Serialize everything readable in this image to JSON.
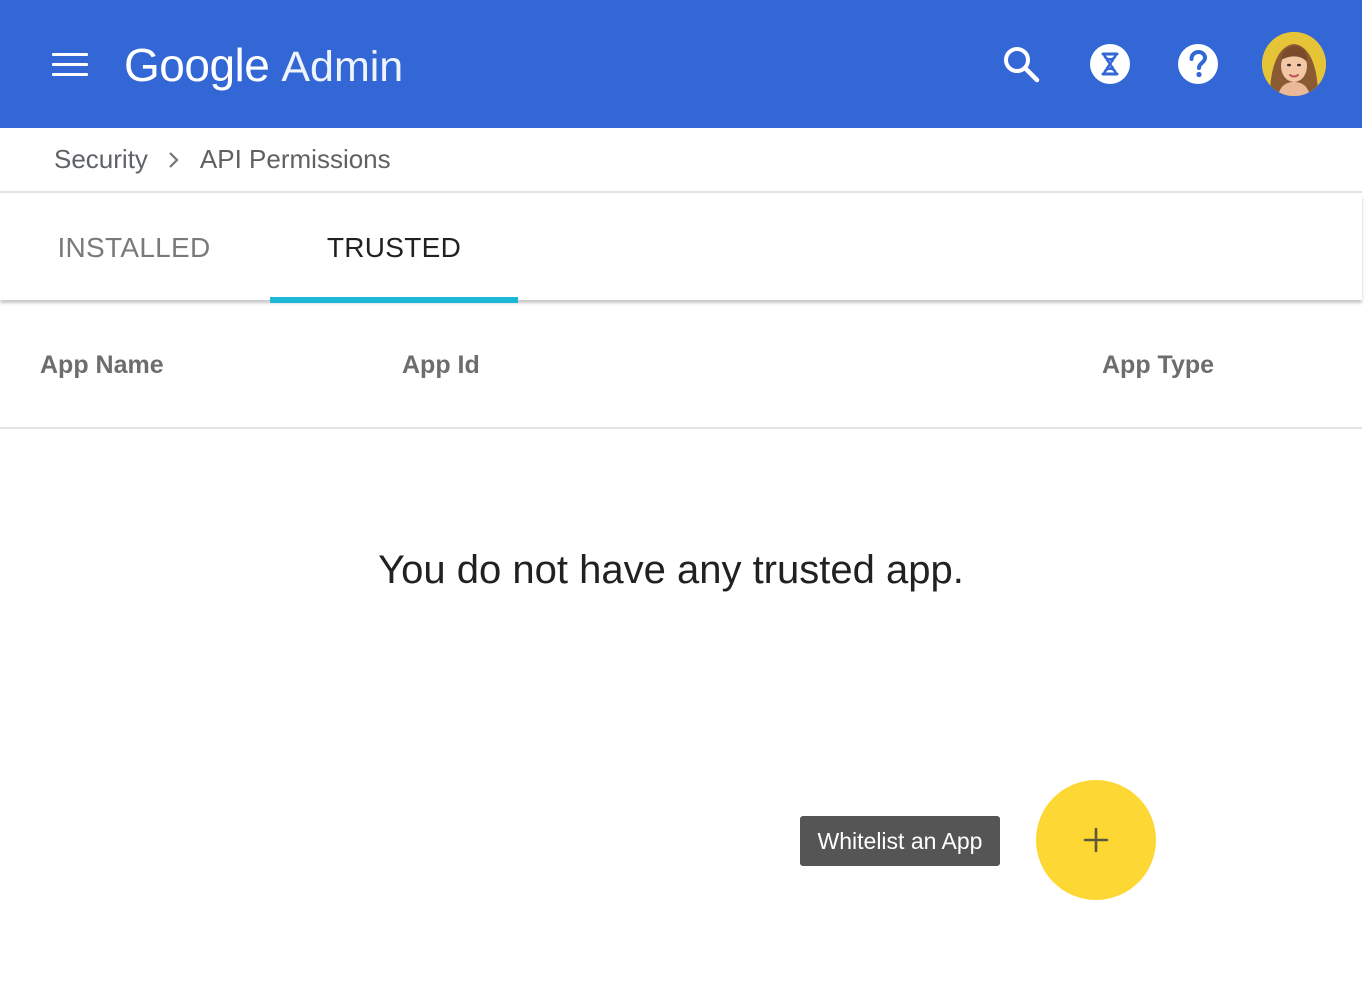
{
  "header": {
    "brand_google": "Google",
    "brand_product": "Admin",
    "bg_color": "#3367d6",
    "icons": [
      "menu-icon",
      "search-icon",
      "timer-icon",
      "help-icon"
    ]
  },
  "breadcrumb": {
    "parent": "Security",
    "current": "API Permissions"
  },
  "tabs": [
    {
      "label": "INSTALLED",
      "selected": false
    },
    {
      "label": "TRUSTED",
      "selected": true
    }
  ],
  "table": {
    "columns": [
      "App Name",
      "App Id",
      "App Type"
    ]
  },
  "empty_state": {
    "message": "You do not have any trusted app."
  },
  "fab": {
    "tooltip": "Whitelist an App",
    "icon": "plus-icon",
    "color": "#fdd835"
  },
  "accent": {
    "tab_indicator": "#1ab8d6"
  }
}
